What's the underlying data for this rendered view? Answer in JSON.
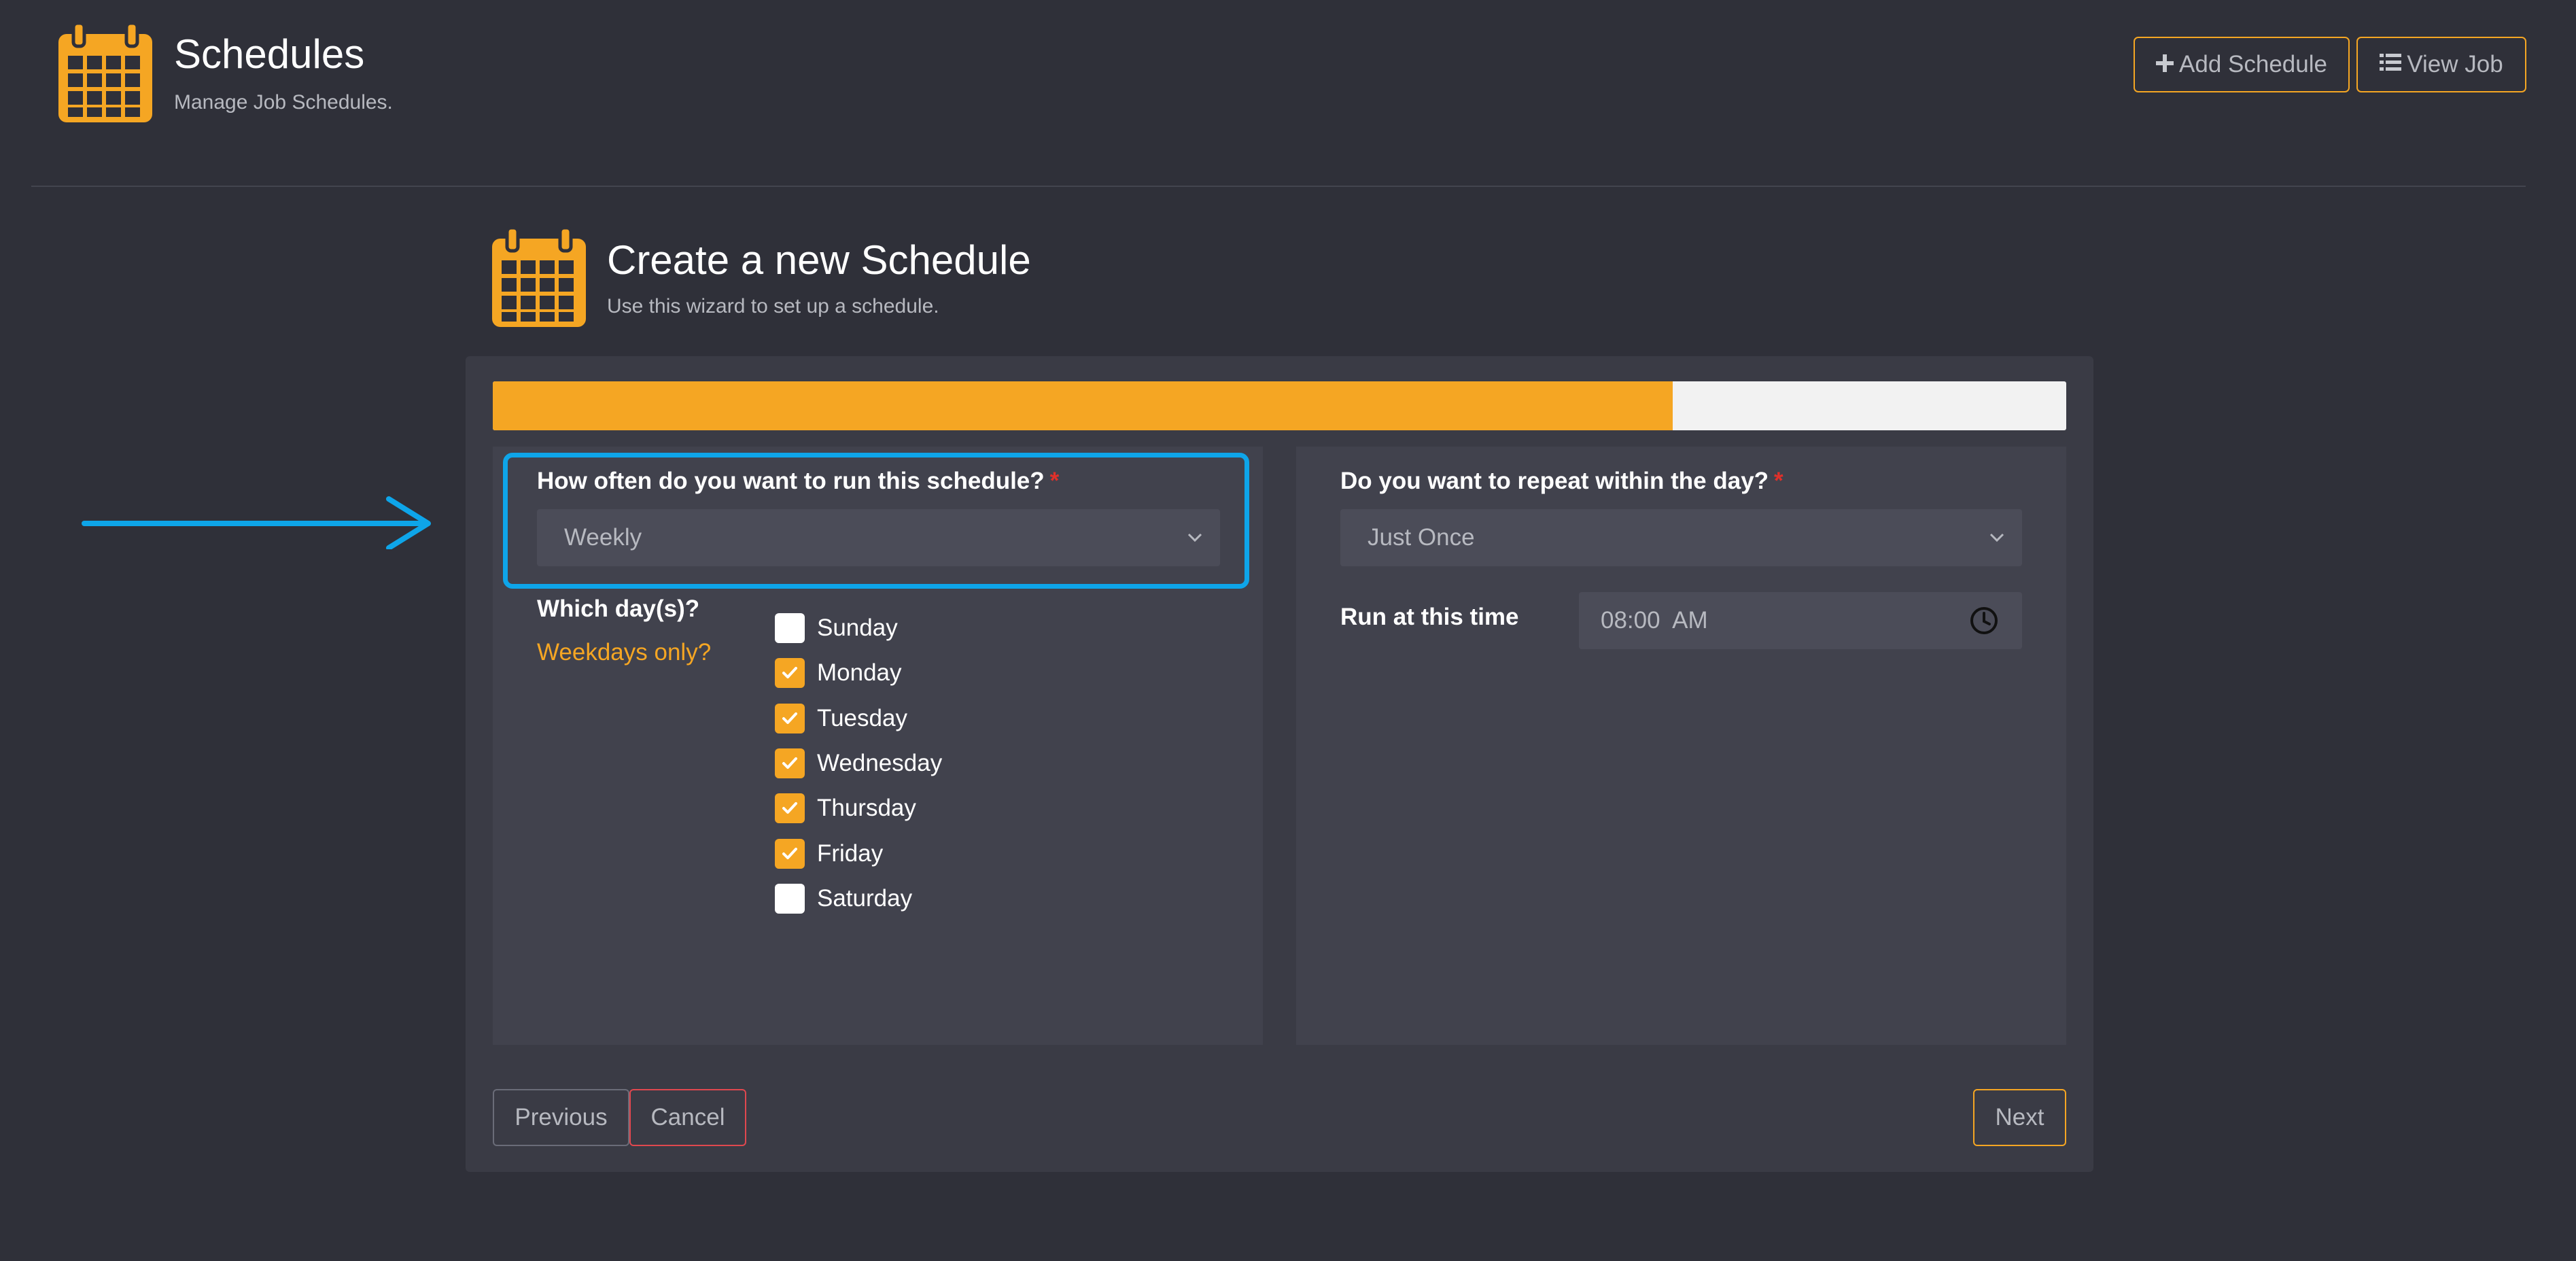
{
  "header": {
    "title": "Schedules",
    "subtitle": "Manage Job Schedules.",
    "add_schedule_label": "Add Schedule",
    "view_job_label": "View Job"
  },
  "wizard": {
    "title": "Create a new Schedule",
    "subtitle": "Use this wizard to set up a schedule.",
    "progress_fraction": 0.75
  },
  "frequency": {
    "label": "How often do you want to run this schedule?",
    "required_mark": "*",
    "value": "Weekly"
  },
  "days": {
    "label": "Which day(s)?",
    "weekdays_link": "Weekdays only?",
    "items": [
      {
        "label": "Sunday",
        "checked": false
      },
      {
        "label": "Monday",
        "checked": true
      },
      {
        "label": "Tuesday",
        "checked": true
      },
      {
        "label": "Wednesday",
        "checked": true
      },
      {
        "label": "Thursday",
        "checked": true
      },
      {
        "label": "Friday",
        "checked": true
      },
      {
        "label": "Saturday",
        "checked": false
      }
    ]
  },
  "repeat": {
    "label": "Do you want to repeat within the day?",
    "required_mark": "*",
    "value": "Just Once"
  },
  "run_time": {
    "label": "Run at this time",
    "value": "08:00  AM"
  },
  "footer": {
    "previous_label": "Previous",
    "cancel_label": "Cancel",
    "next_label": "Next"
  },
  "colors": {
    "accent": "#f5a623",
    "highlight": "#0ea5e9",
    "danger": "#e0484f",
    "background": "#2f3039"
  }
}
